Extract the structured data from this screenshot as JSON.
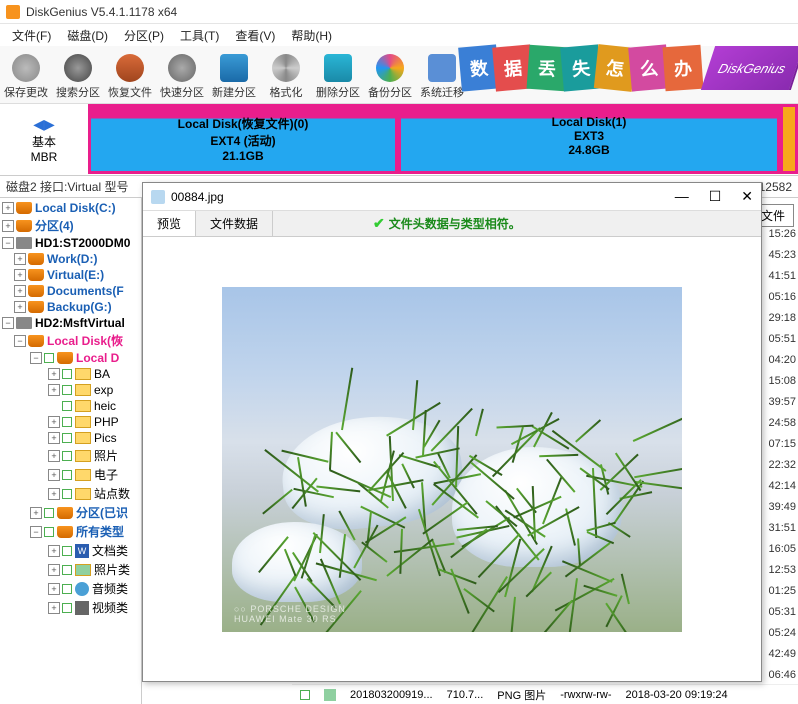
{
  "app": {
    "title": "DiskGenius V5.4.1.1178 x64"
  },
  "menu": [
    "文件(F)",
    "磁盘(D)",
    "分区(P)",
    "工具(T)",
    "查看(V)",
    "帮助(H)"
  ],
  "toolbar": [
    {
      "label": "保存更改",
      "color": "#888"
    },
    {
      "label": "搜索分区",
      "color": "#555"
    },
    {
      "label": "恢复文件",
      "color": "#c94e2e"
    },
    {
      "label": "快速分区",
      "color": "#777"
    },
    {
      "label": "新建分区",
      "color": "#2e7fbf"
    },
    {
      "label": "格式化",
      "color": "#777"
    },
    {
      "label": "删除分区",
      "color": "#26a5c9"
    },
    {
      "label": "备份分区",
      "color": "#e34a88"
    },
    {
      "label": "系统迁移",
      "color": "#5a8fd6"
    }
  ],
  "promo": {
    "cards": [
      {
        "t": "数",
        "c": "#3a7fd6"
      },
      {
        "t": "据",
        "c": "#e44d4d"
      },
      {
        "t": "丢",
        "c": "#2aa86a"
      },
      {
        "t": "失",
        "c": "#1a9c9c"
      },
      {
        "t": "怎",
        "c": "#e09a1e"
      },
      {
        "t": "么",
        "c": "#d34aa0"
      },
      {
        "t": "办",
        "c": "#e6683c"
      }
    ],
    "brand": "DiskGenius"
  },
  "diskmap": {
    "basic": "基本",
    "mbr": "MBR",
    "p0": {
      "name": "Local Disk(恢复文件)(0)",
      "fs": "EXT4 (活动)",
      "size": "21.1GB"
    },
    "p1": {
      "name": "Local Disk(1)",
      "fs": "EXT3",
      "size": "24.8GB"
    }
  },
  "strip": {
    "left": "磁盘2 接口:Virtual 型号",
    "right": "12582"
  },
  "tree": {
    "n0": "Local Disk(C:)",
    "n1": "分区(4)",
    "n2": "HD1:ST2000DM0",
    "n3": "Work(D:)",
    "n4": "Virtual(E:)",
    "n5": "Documents(F",
    "n6": "Backup(G:)",
    "n7": "HD2:MsftVirtual",
    "n8": "Local Disk(恢",
    "n9": "Local D",
    "f0": "BA",
    "f1": "exp",
    "f2": "heic",
    "f3": "PHP",
    "f4": "Pics",
    "f5": "照片",
    "f6": "电子",
    "f7": "站点数",
    "n10": "分区(已识",
    "n11": "所有类型",
    "n12": "文档类",
    "n13": "照片类",
    "n14": "音频类",
    "n15": "视频类"
  },
  "rtab": "文件",
  "times": [
    "15:26",
    "45:23",
    "41:51",
    "05:16",
    "29:18",
    "05:51",
    "04:20",
    "15:08",
    "39:57",
    "24:58",
    "07:15",
    "22:32",
    "42:14",
    "39:49",
    "31:51",
    "16:05",
    "12:53",
    "01:25",
    "05:31",
    "05:24",
    "42:49",
    "06:46"
  ],
  "filerow": {
    "name": "20180320091​9...",
    "size": "710.7...",
    "type": "PNG 图片",
    "perm": "-rwxrw-rw-",
    "date": "2018-03-20 09:19:24"
  },
  "preview": {
    "file": "00884.jpg",
    "tab1": "预览",
    "tab2": "文件数据",
    "msg": "文件头数据与类型相符。",
    "wm1": "○○ PORSCHE DESIGN",
    "wm2": "HUAWEI Mate 30 RS"
  }
}
